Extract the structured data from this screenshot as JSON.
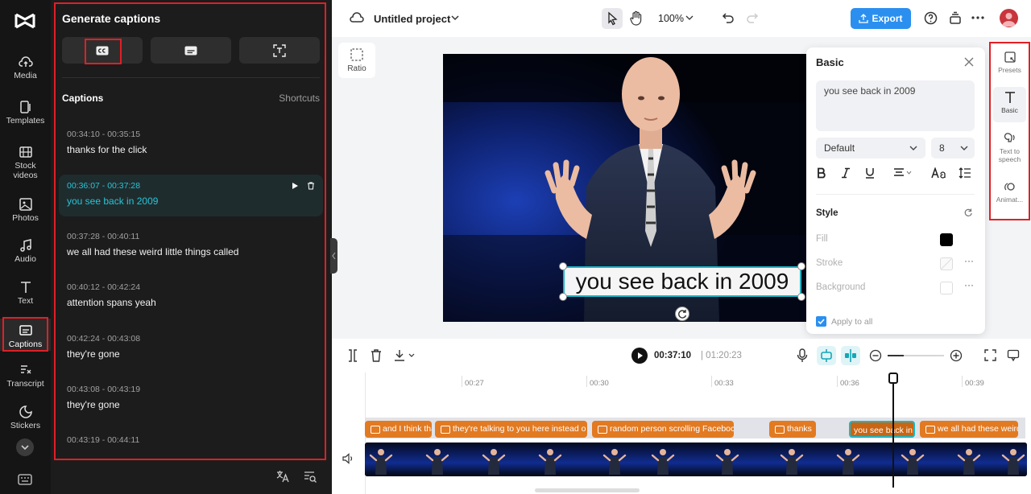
{
  "rail": {
    "items": [
      {
        "label": "Media",
        "icon": "cloud-upload-icon"
      },
      {
        "label": "Templates",
        "icon": "templates-icon"
      },
      {
        "label1": "Stock",
        "label2": "videos",
        "icon": "film-icon"
      },
      {
        "label": "Photos",
        "icon": "image-icon"
      },
      {
        "label": "Audio",
        "icon": "music-note-icon"
      },
      {
        "label": "Text",
        "icon": "text-icon"
      },
      {
        "label": "Captions",
        "icon": "captions-icon",
        "active": true
      },
      {
        "label": "Transcript",
        "icon": "transcript-icon"
      },
      {
        "label": "Stickers",
        "icon": "sticker-icon"
      }
    ]
  },
  "panel": {
    "title": "Generate captions",
    "captions_heading": "Captions",
    "shortcuts_label": "Shortcuts",
    "captions": [
      {
        "time": "00:34:10 - 00:35:15",
        "text": "thanks for the click"
      },
      {
        "time": "00:36:07 - 00:37:28",
        "text": "you see back in 2009",
        "active": true
      },
      {
        "time": "00:37:28 - 00:40:11",
        "text": "we all had these weird little things called"
      },
      {
        "time": "00:40:12 - 00:42:24",
        "text": "attention spans yeah"
      },
      {
        "time": "00:42:24 - 00:43:08",
        "text": "they're gone"
      },
      {
        "time": "00:43:08 - 00:43:19",
        "text": "they're gone"
      },
      {
        "time": "00:43:19 - 00:44:11",
        "text": ""
      }
    ]
  },
  "topbar": {
    "project_name": "Untitled project",
    "zoom": "100%",
    "export_label": "Export"
  },
  "canvas": {
    "ratio_label": "Ratio",
    "caption_overlay": "you see back in 2009"
  },
  "basic": {
    "title": "Basic",
    "text_value": "you see back in 2009",
    "font": "Default",
    "font_size": "8",
    "style_heading": "Style",
    "fill_label": "Fill",
    "stroke_label": "Stroke",
    "background_label": "Background",
    "apply_all_label": "Apply to all",
    "fill_color": "#000000"
  },
  "right_rail": {
    "presets": "Presets",
    "basic": "Basic",
    "tts1": "Text to",
    "tts2": "speech",
    "animation": "Animat..."
  },
  "timeline": {
    "current_time": "00:37:10",
    "total_time": "| 01:20:23",
    "ticks": [
      "00:27",
      "00:30",
      "00:33",
      "00:36",
      "00:39"
    ],
    "clips": [
      "and I think that",
      "they're talking to you here instead o",
      "random person scrolling Faceboc",
      "thanks",
      "you see back in",
      "we all had these weird"
    ]
  },
  "colors": {
    "accent": "#2b8ff0",
    "highlight": "#e01f26",
    "caption_active": "#29c4d6",
    "clip": "#e27a22"
  }
}
